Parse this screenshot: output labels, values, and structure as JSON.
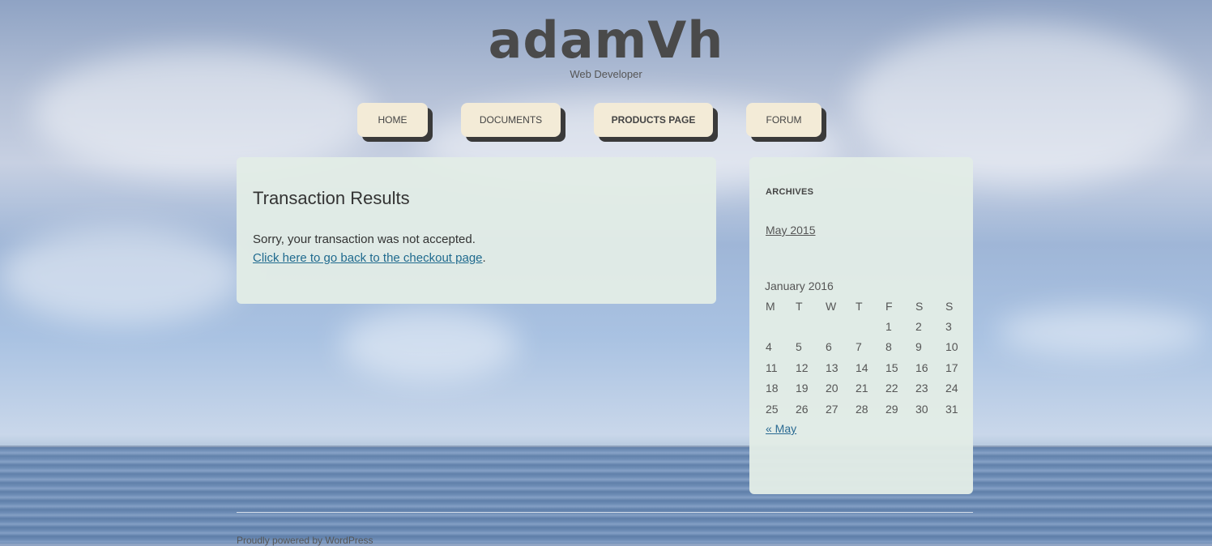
{
  "site": {
    "title": "adamVh",
    "tagline": "Web Developer"
  },
  "nav": [
    {
      "label": "HOME",
      "current": false
    },
    {
      "label": "DOCUMENTS",
      "current": false
    },
    {
      "label": "PRODUCTS PAGE",
      "current": true
    },
    {
      "label": "FORUM",
      "current": false
    }
  ],
  "content": {
    "title": "Transaction Results",
    "message": "Sorry, your transaction was not accepted.",
    "link_text": "Click here to go back to the checkout page",
    "link_suffix": "."
  },
  "sidebar": {
    "archives_title": "ARCHIVES",
    "archive_link": "May 2015",
    "calendar": {
      "caption": "January 2016",
      "weekdays": [
        "M",
        "T",
        "W",
        "T",
        "F",
        "S",
        "S"
      ],
      "weeks": [
        [
          "",
          "",
          "",
          "",
          "1",
          "2",
          "3"
        ],
        [
          "4",
          "5",
          "6",
          "7",
          "8",
          "9",
          "10"
        ],
        [
          "11",
          "12",
          "13",
          "14",
          "15",
          "16",
          "17"
        ],
        [
          "18",
          "19",
          "20",
          "21",
          "22",
          "23",
          "24"
        ],
        [
          "25",
          "26",
          "27",
          "28",
          "29",
          "30",
          "31"
        ]
      ],
      "prev_link": "« May"
    }
  },
  "footer": {
    "text": "Proudly powered by WordPress"
  }
}
